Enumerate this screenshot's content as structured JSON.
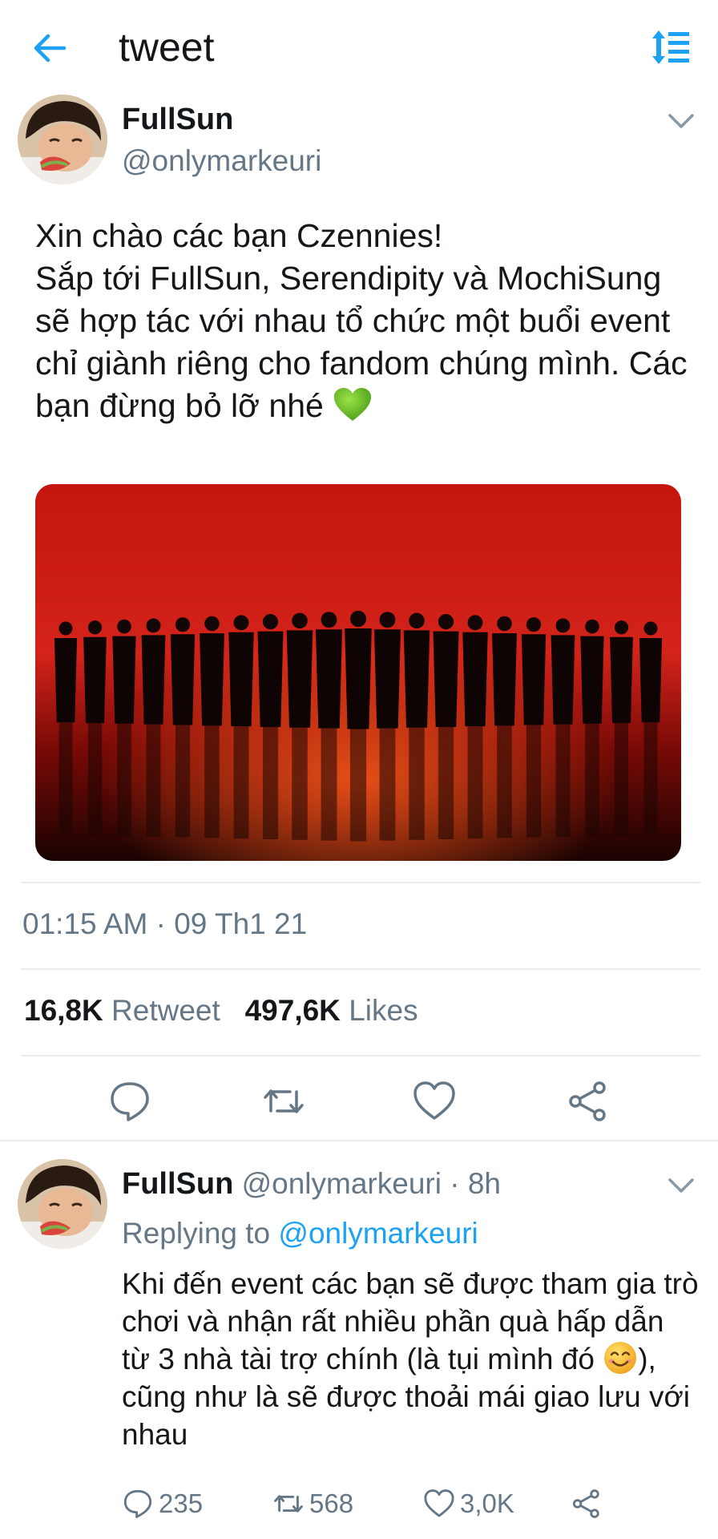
{
  "header": {
    "title": "tweet",
    "back_icon": "arrow-left-icon",
    "sort_icon": "sort-icon",
    "accent": "#1da1f2"
  },
  "tweet": {
    "name": "FullSun",
    "handle": "@onlymarkeuri",
    "text_line1": "Xin chào các bạn Czennies!",
    "text_rest": "Sắp tới FullSun, Serendipity và MochiSung sẽ hợp tác với nhau tổ chức một buổi event chỉ giành riêng cho fandom chúng mình. Các bạn đừng bỏ lỡ nhé",
    "emoji": "green-heart",
    "timestamp": "01:15 AM · 09 Th1 21",
    "retweets": "16,8K",
    "retweets_label": "Retweet",
    "likes": "497,6K",
    "likes_label": "Likes"
  },
  "reply": {
    "name": "FullSun",
    "meta": "@onlymarkeuri · 8h",
    "replying_label": "Replying to",
    "replying_handle": "@onlymarkeuri",
    "text_part1": "Khi đến event các bạn sẽ được tham gia trò chơi và nhận rất nhiều phần quà hấp dẫn từ 3 nhà tài trợ chính (là tụi mình đó ",
    "text_part2": "), cũng như là sẽ được thoải mái giao lưu với nhau",
    "emoji": "smiling-face",
    "reply_count": "235",
    "retweet_count": "568",
    "like_count": "3,0K"
  }
}
